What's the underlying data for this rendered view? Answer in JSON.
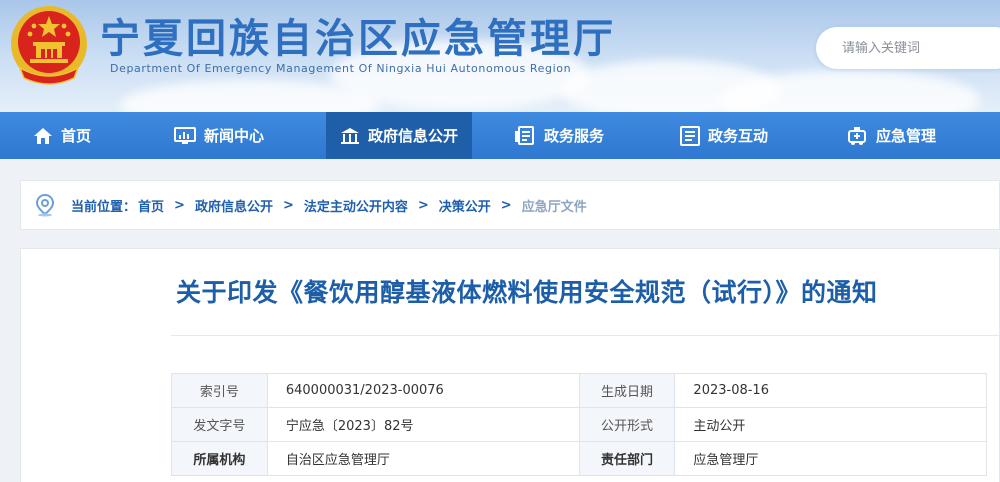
{
  "site": {
    "title": "宁夏回族自治区应急管理厅",
    "subtitle": "Department Of Emergency Management Of Ningxia Hui Autonomous Region"
  },
  "search": {
    "placeholder": "请输入关键词"
  },
  "nav": {
    "items": [
      {
        "label": "首页",
        "icon": "home-icon"
      },
      {
        "label": "新闻中心",
        "icon": "monitor-chart-icon"
      },
      {
        "label": "政府信息公开",
        "icon": "government-building-icon",
        "active": true
      },
      {
        "label": "政务服务",
        "icon": "service-document-icon"
      },
      {
        "label": "政务互动",
        "icon": "interaction-list-icon"
      },
      {
        "label": "应急管理",
        "icon": "emergency-vehicle-icon"
      }
    ]
  },
  "breadcrumb": {
    "icon": "location-pin-icon",
    "label": "当前位置：",
    "items": [
      "首页",
      "政府信息公开",
      "法定主动公开内容",
      "决策公开"
    ],
    "current": "应急厅文件",
    "separator": ">"
  },
  "article": {
    "title": "关于印发《餐饮用醇基液体燃料使用安全规范（试行）》的通知"
  },
  "meta": {
    "rows": [
      {
        "k1": "索引号",
        "v1": "640000031/2023-00076",
        "k2": "生成日期",
        "v2": "2023-08-16"
      },
      {
        "k1": "发文字号",
        "v1": "宁应急〔2023〕82号",
        "k2": "公开形式",
        "v2": "主动公开"
      },
      {
        "k1": "所属机构",
        "v1": "自治区应急管理厅",
        "k2": "责任部门",
        "v2": "应急管理厅"
      }
    ]
  },
  "colors": {
    "nav": "#3584d8",
    "nav_active": "#1f5ea9",
    "title": "#1d5ea9",
    "breadcrumb": "#1f5fae",
    "emblem_red": "#d8241c",
    "emblem_gold": "#f2c230"
  }
}
